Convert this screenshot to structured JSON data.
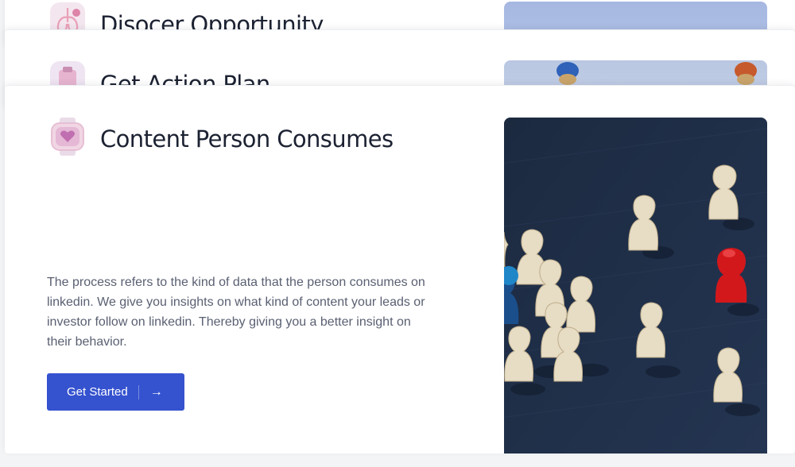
{
  "cards": [
    {
      "title": "Disocer Opportunity",
      "icon": "lungs-icon"
    },
    {
      "title": "Get Action Plan",
      "icon": "clipboard-icon"
    },
    {
      "title": "Content Person Consumes",
      "icon": "smartwatch-heart-icon",
      "description": "The process refers to the kind of data that the person consumes on linkedin. We give you insights on what kind of content your leads or investor follow on linkedin. Thereby giving you a better insight on their behavior.",
      "button_label": "Get Started",
      "button_icon": "arrow-right-icon",
      "image": "wooden-pawns-red-figure-photo"
    }
  ],
  "colors": {
    "button": "#3552cf",
    "title": "#1c2232",
    "body_text": "#5a6072",
    "image_bg": "#1f2d44",
    "accent_pawn": "#d3181c"
  }
}
